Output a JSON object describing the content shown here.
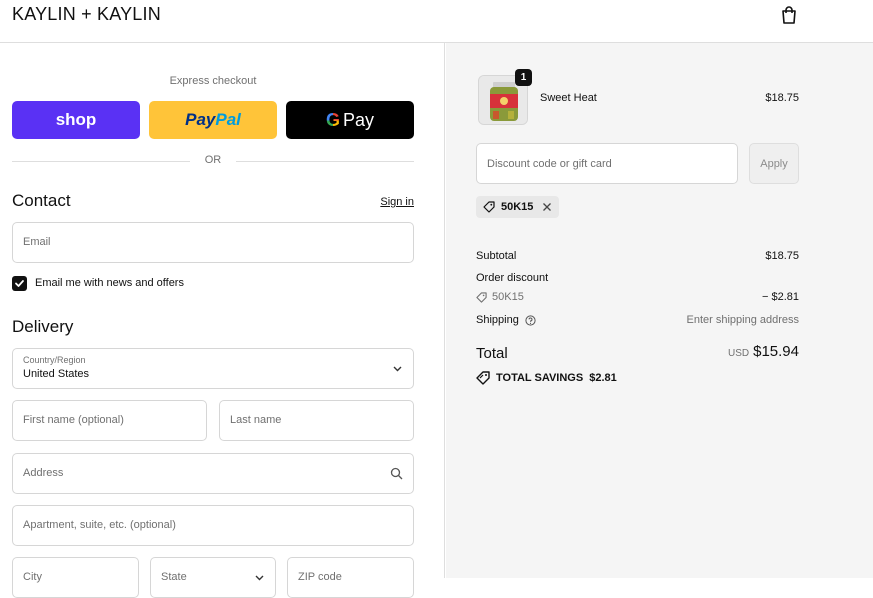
{
  "header": {
    "brand": "KAYLIN + KAYLIN",
    "cart_icon": "shopping-bag-icon"
  },
  "express": {
    "label": "Express checkout",
    "shop_label": "shop",
    "paypal_label_a": "Pay",
    "paypal_label_b": "Pal",
    "gpay_g": "G",
    "gpay_label": "Pay",
    "or": "OR"
  },
  "contact": {
    "title": "Contact",
    "sign_in": "Sign in",
    "email_placeholder": "Email",
    "news_label": "Email me with news and offers",
    "news_checked": true
  },
  "delivery": {
    "title": "Delivery",
    "country_label": "Country/Region",
    "country_value": "United States",
    "first_name_placeholder": "First name (optional)",
    "last_name_placeholder": "Last name",
    "address_placeholder": "Address",
    "apartment_placeholder": "Apartment, suite, etc. (optional)",
    "city_placeholder": "City",
    "state_placeholder": "State",
    "zip_placeholder": "ZIP code"
  },
  "summary": {
    "product": {
      "name": "Sweet Heat",
      "price": "$18.75",
      "quantity": "1"
    },
    "discount_placeholder": "Discount code or gift card",
    "apply_label": "Apply",
    "applied_code": "50K15",
    "subtotal_label": "Subtotal",
    "subtotal_value": "$18.75",
    "order_discount_label": "Order discount",
    "order_discount_code": "50K15",
    "order_discount_value": "− $2.81",
    "shipping_label": "Shipping",
    "shipping_value": "Enter shipping address",
    "total_label": "Total",
    "total_currency": "USD",
    "total_value": "$15.94",
    "savings_label": "TOTAL SAVINGS",
    "savings_value": "$2.81"
  },
  "colors": {
    "shop": "#5a31f4",
    "paypal": "#ffc439",
    "gpay": "#000000",
    "summary_bg": "#f5f5f5"
  }
}
